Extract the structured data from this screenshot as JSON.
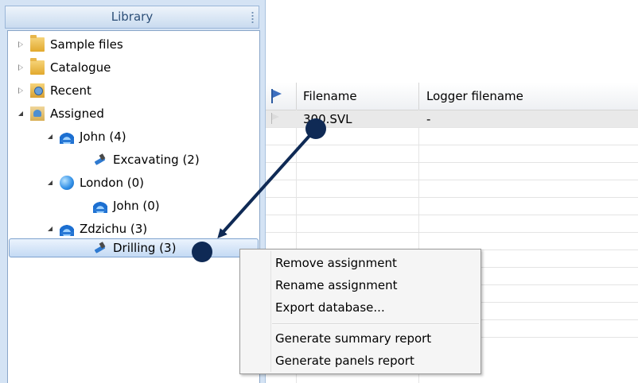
{
  "library": {
    "title": "Library",
    "tree": [
      {
        "label": "Sample files",
        "icon": "folder-icon",
        "expander": "collapsed"
      },
      {
        "label": "Catalogue",
        "icon": "folder-icon",
        "expander": "collapsed"
      },
      {
        "label": "Recent",
        "icon": "recent-folder-icon",
        "expander": "collapsed"
      },
      {
        "label": "Assigned",
        "icon": "assigned-folder-icon",
        "expander": "expanded"
      },
      {
        "label": "John (4)",
        "icon": "hard-hat-icon",
        "expander": "expanded"
      },
      {
        "label": "Excavating (2)",
        "icon": "drill-icon",
        "expander": "none"
      },
      {
        "label": "London (0)",
        "icon": "globe-icon",
        "expander": "expanded"
      },
      {
        "label": "John (0)",
        "icon": "hard-hat-icon",
        "expander": "none"
      },
      {
        "label": "Zdzichu (3)",
        "icon": "hard-hat-icon",
        "expander": "expanded"
      },
      {
        "label": "Drilling (3)",
        "icon": "drill-icon",
        "expander": "none",
        "selected": true
      }
    ]
  },
  "grid": {
    "columns": [
      "Filename",
      "Logger filename"
    ],
    "rows": [
      {
        "filename": "300.SVL",
        "logger_filename": "-"
      }
    ]
  },
  "context_menu": {
    "items": [
      "Remove assignment",
      "Rename assignment",
      "Export database...",
      "Generate summary report",
      "Generate panels report"
    ]
  },
  "colors": {
    "library_bg": "#d4e3f4",
    "annotation_arrow": "#0f2a55",
    "selection_border": "#7da2ce"
  }
}
